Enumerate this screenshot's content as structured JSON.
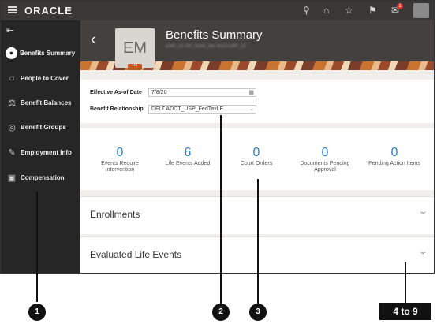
{
  "app": {
    "brand": "ORACLE"
  },
  "topbar_icons": [
    "search-icon",
    "home-icon",
    "star-icon",
    "flag-icon",
    "notifications-icon"
  ],
  "notification_count": "1",
  "sidebar": {
    "items": [
      {
        "label": "Benefits Summary",
        "icon": "person-icon",
        "active": true
      },
      {
        "label": "People to Cover",
        "icon": "home-icon"
      },
      {
        "label": "Benefit Balances",
        "icon": "balance-icon"
      },
      {
        "label": "Benefit Groups",
        "icon": "groups-icon"
      },
      {
        "label": "Employment Info",
        "icon": "briefcase-icon"
      },
      {
        "label": "Compensation",
        "icon": "money-icon"
      }
    ]
  },
  "header": {
    "title": "Benefits Summary",
    "initials": "EM",
    "more": "•••",
    "subtitle": "EMP_01 HR_4056_Ver 0023 EMP_01"
  },
  "form": {
    "effective_label": "Effective As-of Date",
    "effective_value": "7/8/20",
    "relationship_label": "Benefit Relationship",
    "relationship_value": "DFLT ADDT_USP_FedTaxLE"
  },
  "stats": [
    {
      "value": "0",
      "label": "Events Require Intervention"
    },
    {
      "value": "6",
      "label": "Life Events Added"
    },
    {
      "value": "0",
      "label": "Court Orders"
    },
    {
      "value": "0",
      "label": "Documents Pending Approval"
    },
    {
      "value": "0",
      "label": "Pending Action Items"
    }
  ],
  "sections": [
    {
      "title": "Enrollments"
    },
    {
      "title": "Evaluated Life Events"
    }
  ],
  "callouts": [
    "1",
    "2",
    "3",
    "4 to 9"
  ],
  "colors": {
    "accent": "#2a80c5",
    "topbar": "#3a3836",
    "sidebar": "#262626"
  }
}
